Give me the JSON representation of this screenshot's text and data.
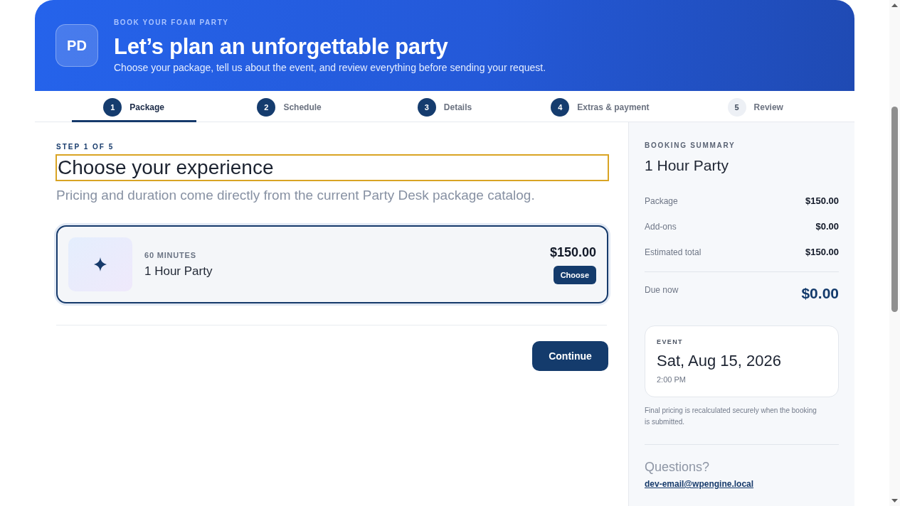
{
  "header": {
    "logo": "PD",
    "eyebrow": "BOOK YOUR FOAM PARTY",
    "title": "Let’s plan an unforgettable party",
    "subtitle": "Choose your package, tell us about the event, and review everything before sending your request."
  },
  "steps": [
    {
      "number": "1",
      "label": "Package",
      "selected": true,
      "disabled": false
    },
    {
      "number": "2",
      "label": "Schedule",
      "selected": false,
      "disabled": false
    },
    {
      "number": "3",
      "label": "Details",
      "selected": false,
      "disabled": false
    },
    {
      "number": "4",
      "label": "Extras & payment",
      "selected": false,
      "disabled": false
    },
    {
      "number": "5",
      "label": "Review",
      "selected": false,
      "disabled": true
    }
  ],
  "content": {
    "eyebrow": "STEP 1 OF 5",
    "heading": {
      "text": "Choose your experience",
      "focused": true
    },
    "description": "Pricing and duration come directly from the current Party Desk package catalog.",
    "packages": [
      {
        "duration": "60 MINUTES",
        "name": "1 Hour Party",
        "price": "$150.00",
        "button": "Choose",
        "selected": true
      }
    ],
    "continue_button": "Continue"
  },
  "summary": {
    "eyebrow": "BOOKING SUMMARY",
    "package_name": "1 Hour Party",
    "lines": [
      {
        "label": "Package",
        "value": "$150.00"
      },
      {
        "label": "Add-ons",
        "value": "$0.00"
      },
      {
        "label": "Estimated total",
        "value": "$150.00"
      }
    ],
    "due": {
      "label": "Due now",
      "value": "$0.00"
    },
    "event": {
      "eyebrow": "EVENT",
      "date": "Sat, Aug 15, 2026",
      "time": "2:00 PM"
    },
    "note": "Final pricing is recalculated securely when the booking is submitted.",
    "questions": {
      "heading": "Questions?",
      "email": "dev-email@wpengine.local"
    }
  }
}
